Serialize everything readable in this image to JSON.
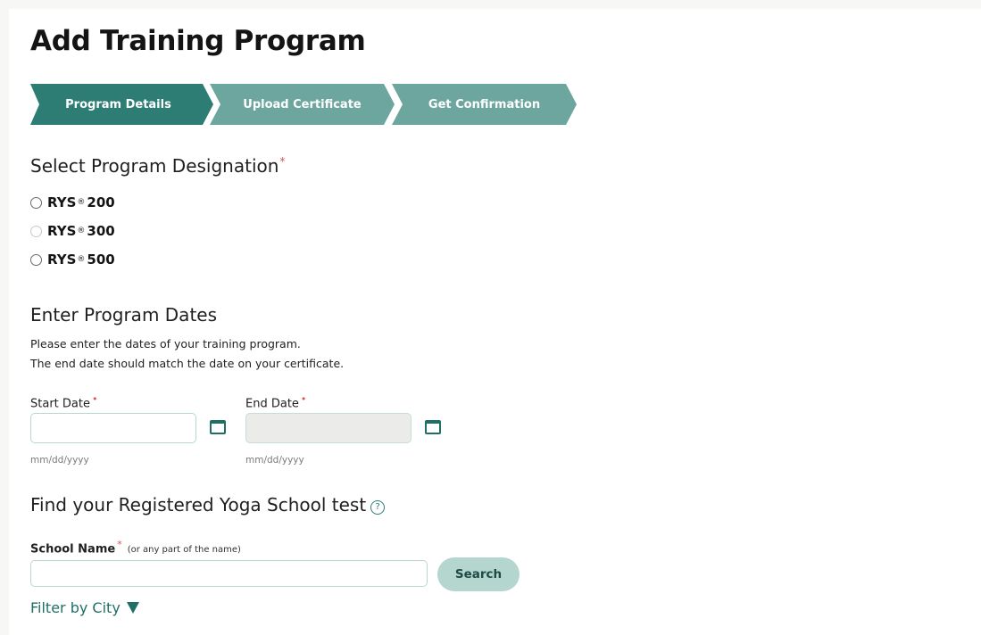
{
  "page": {
    "title": "Add Training Program"
  },
  "stepper": {
    "steps": [
      {
        "label": "Program Details",
        "active": true
      },
      {
        "label": "Upload Certificate",
        "active": false
      },
      {
        "label": "Get Confirmation",
        "active": false
      }
    ],
    "colors": {
      "active": "#2e7d74",
      "inactive": "#6da69e"
    }
  },
  "designation": {
    "title": "Select Program Designation",
    "required_mark": "*",
    "options": [
      {
        "prefix": "RYS",
        "reg": "®",
        "value": "200",
        "disabled": false
      },
      {
        "prefix": "RYS",
        "reg": "®",
        "value": "300",
        "disabled": true
      },
      {
        "prefix": "RYS",
        "reg": "®",
        "value": "500",
        "disabled": false
      }
    ]
  },
  "dates": {
    "title": "Enter Program Dates",
    "helper_line1": "Please enter the dates of your training program.",
    "helper_line2": "The end date should match the date on your certificate.",
    "start_label": "Start Date",
    "end_label": "End Date",
    "required_mark": "•",
    "start_value": "",
    "end_value": "",
    "start_hint": "mm/dd/yyyy",
    "end_hint": "mm/dd/yyyy",
    "icon": "calendar-icon"
  },
  "school": {
    "title": "Find your Registered Yoga School test",
    "help_icon": "question-circle-icon",
    "help_glyph": "?",
    "name_label": "School Name",
    "required_mark": "*",
    "name_hint": "(or any part of the name)",
    "name_value": "",
    "search_label": "Search",
    "filter_label": "Filter by City"
  }
}
